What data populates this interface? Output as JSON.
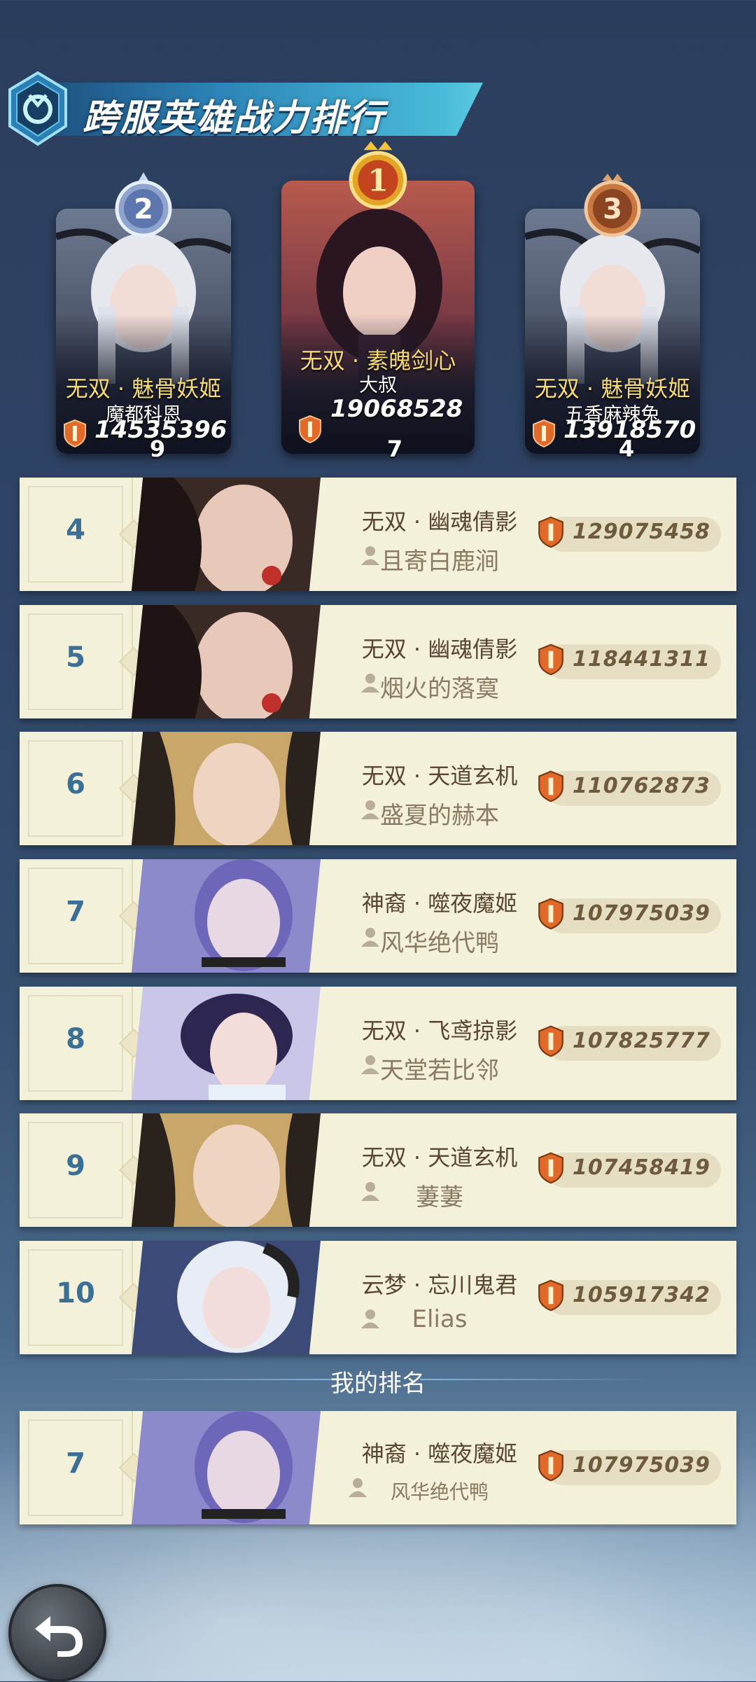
{
  "title": "跨服英雄战力排行",
  "top3": [
    {
      "rank_label": "2",
      "hero": "无双 · 魅骨妖姬",
      "player": "魔都科恩",
      "power": "14535396",
      "sub": "9"
    },
    {
      "rank_label": "1",
      "hero": "无双 · 素魄剑心",
      "player": "大叔",
      "power": "19068528",
      "sub": "7"
    },
    {
      "rank_label": "3",
      "hero": "无双 · 魅骨妖姬",
      "player": "五香麻辣兔",
      "power": "13918570",
      "sub": "4"
    }
  ],
  "rows": [
    {
      "rank": "4",
      "hero": "无双 · 幽魂倩影",
      "player": "且寄白鹿涧",
      "power": "129075458"
    },
    {
      "rank": "5",
      "hero": "无双 · 幽魂倩影",
      "player": "烟火的落寞",
      "power": "118441311"
    },
    {
      "rank": "6",
      "hero": "无双 · 天道玄机",
      "player": "盛夏的赫本",
      "power": "110762873"
    },
    {
      "rank": "7",
      "hero": "神裔 · 噬夜魔姬",
      "player": "风华绝代鸭",
      "power": "107975039"
    },
    {
      "rank": "8",
      "hero": "无双 · 飞鸢掠影",
      "player": "天堂若比邻",
      "power": "107825777"
    },
    {
      "rank": "9",
      "hero": "无双 · 天道玄机",
      "player": "萋萋",
      "power": "107458419"
    },
    {
      "rank": "10",
      "hero": "云梦 · 忘川鬼君",
      "player": "Elias",
      "power": "105917342"
    }
  ],
  "my_rank_label": "我的排名",
  "my_rank": {
    "rank": "7",
    "hero": "神裔 · 噬夜魔姬",
    "player": "风华绝代鸭",
    "power": "107975039"
  },
  "colors": {
    "gold": "#f6d977",
    "rank_blue": "#3b6f96",
    "row_bg": "#f4f1da"
  },
  "icons": {
    "back": "back-arrow-icon",
    "shield": "power-shield-icon",
    "user": "user-icon"
  }
}
